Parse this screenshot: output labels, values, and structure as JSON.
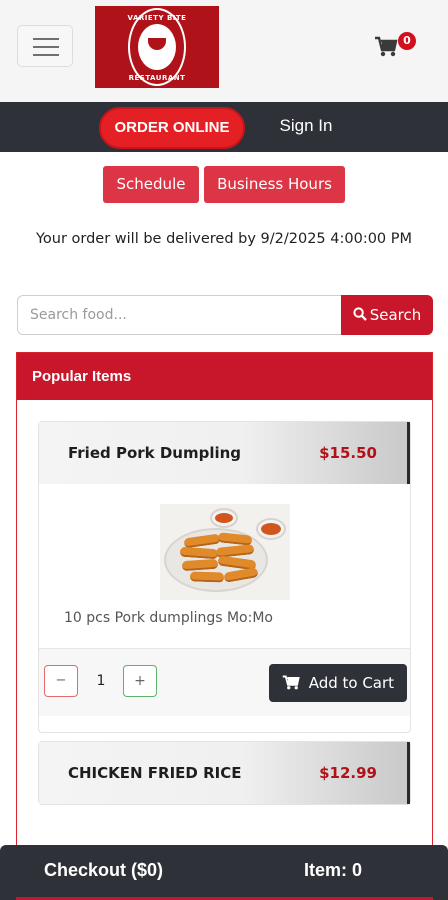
{
  "header": {
    "menu_icon": "hamburger-icon",
    "logo": {
      "top_text": "VARIETY BITE",
      "bottom_text": "RESTAURANT"
    },
    "cart": {
      "icon": "cart-icon",
      "count": "0"
    }
  },
  "nav": {
    "order_online": "ORDER ONLINE",
    "sign_in": "Sign In"
  },
  "actions": {
    "schedule": "Schedule",
    "business_hours": "Business Hours"
  },
  "delivery_text": "Your order will be delivered by 9/2/2025 4:00:00 PM",
  "search": {
    "placeholder": "Search food...",
    "button_label": "Search",
    "icon": "search-icon"
  },
  "popular": {
    "heading": "Popular Items",
    "items": [
      {
        "name": "Fried Pork Dumpling",
        "price": "$15.50",
        "description": "10 pcs Pork dumplings Mo:Mo",
        "quantity": "1",
        "minus": "−",
        "plus": "+",
        "add_label": "Add to Cart"
      },
      {
        "name": "CHICKEN FRIED RICE",
        "price": "$12.99"
      }
    ]
  },
  "checkout": {
    "label": "Checkout ($0)",
    "items": "Item: 0"
  },
  "colors": {
    "accent_red": "#c8162a",
    "nav_dark": "#2e3238",
    "price_red": "#b0121a"
  }
}
